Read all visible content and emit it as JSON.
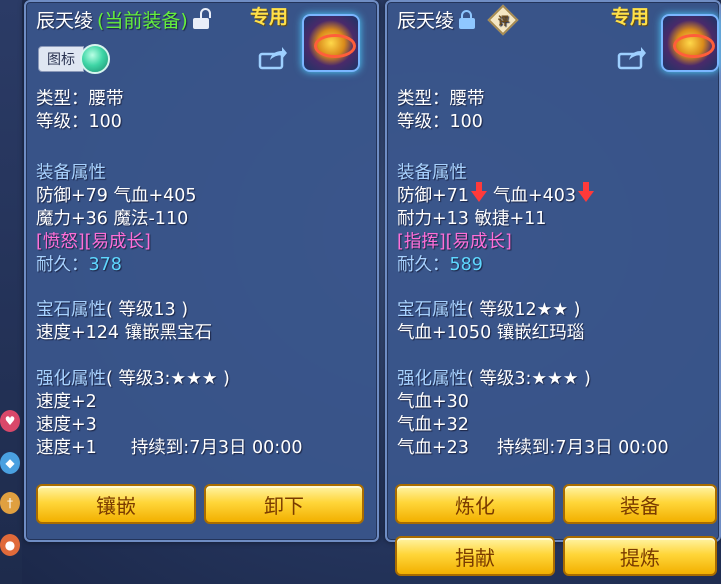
{
  "left_panel": {
    "name": "辰天绫",
    "current_tag": "(当前装备)",
    "exclusive": "专用",
    "icon_toggle_label": "图标",
    "type_line": "类型：腰带",
    "level_line": "等级：100",
    "attr_header": "装备属性",
    "attr_line1": "防御+79 气血+405",
    "attr_line2": "魔力+36 魔法-110",
    "special": "[愤怒][易成长]",
    "durability_label": "耐久：",
    "durability_value": "378",
    "gem_header": "宝石属性",
    "gem_level": "( 等级13 )",
    "gem_line": "速度+124 镶嵌黑宝石",
    "enhance_header": "强化属性",
    "enhance_level": "( 等级3:★★★ )",
    "enhance_lines": [
      "速度+2",
      "速度+3",
      "速度+1"
    ],
    "duration": "持续到:7月3日 00:00",
    "buttons": [
      "镶嵌",
      "卸下"
    ]
  },
  "right_panel": {
    "name": "辰天绫",
    "rating_badge": "评",
    "exclusive": "专用",
    "type_line": "类型：腰带",
    "level_line": "等级：100",
    "attr_header": "装备属性",
    "attr_line1_a": "防御+71",
    "attr_line1_b": "气血+403",
    "attr_line2": "耐力+13 敏捷+11",
    "special": "[指挥][易成长]",
    "durability_label": "耐久：",
    "durability_value": "589",
    "gem_header": "宝石属性",
    "gem_level": "( 等级12★★ )",
    "gem_line": "气血+1050 镶嵌红玛瑙",
    "enhance_header": "强化属性",
    "enhance_level": "( 等级3:★★★ )",
    "enhance_lines": [
      "气血+30",
      "气血+32",
      "气血+23"
    ],
    "duration": "持续到:7月3日 00:00",
    "buttons": [
      "炼化",
      "装备",
      "捐献",
      "提炼"
    ]
  },
  "colors": {
    "panel_bg": "#3a568c",
    "header_text": "#a9d3ff",
    "special_text": "#ff6fd8",
    "durability_value": "#5fd7ff",
    "current_tag": "#64ef3c",
    "exclusive": "#ffe14a",
    "decrease_arrow": "#ff3a3a",
    "button_fill": "#ffd63a"
  }
}
